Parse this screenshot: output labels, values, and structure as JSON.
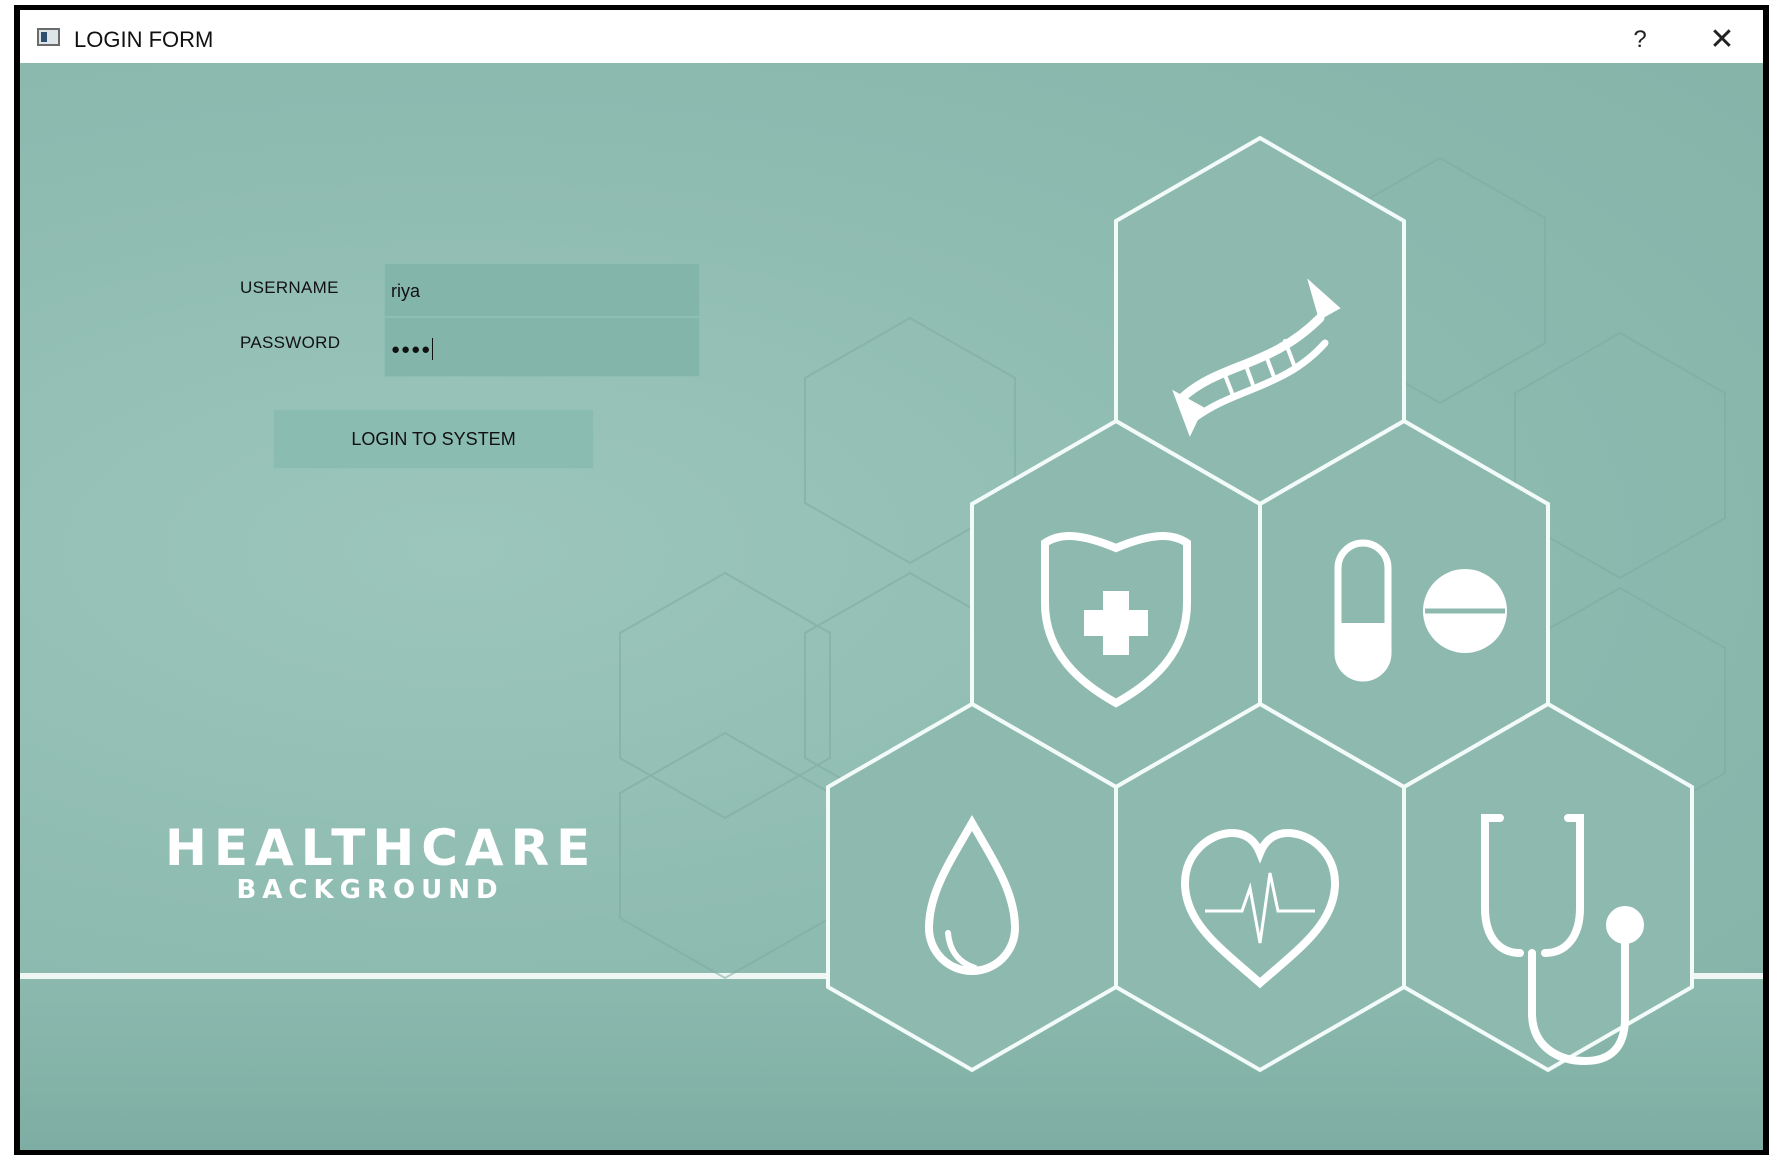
{
  "window": {
    "title": "LOGIN FORM",
    "help_label": "?",
    "close_label": "✕"
  },
  "form": {
    "username_label": "USERNAME",
    "username_value": "riya",
    "password_label": "PASSWORD",
    "password_value": "●●●●",
    "login_button_label": "LOGIN TO SYSTEM"
  },
  "branding": {
    "title": "HEALTHCARE",
    "subtitle": "BACKGROUND"
  },
  "icons": [
    "dna-icon",
    "shield-cross-icon",
    "pills-icon",
    "blood-drop-icon",
    "heartbeat-icon",
    "stethoscope-icon"
  ],
  "colors": {
    "background": "#8fbcb1",
    "hex_outline": "#f2fbf8"
  }
}
